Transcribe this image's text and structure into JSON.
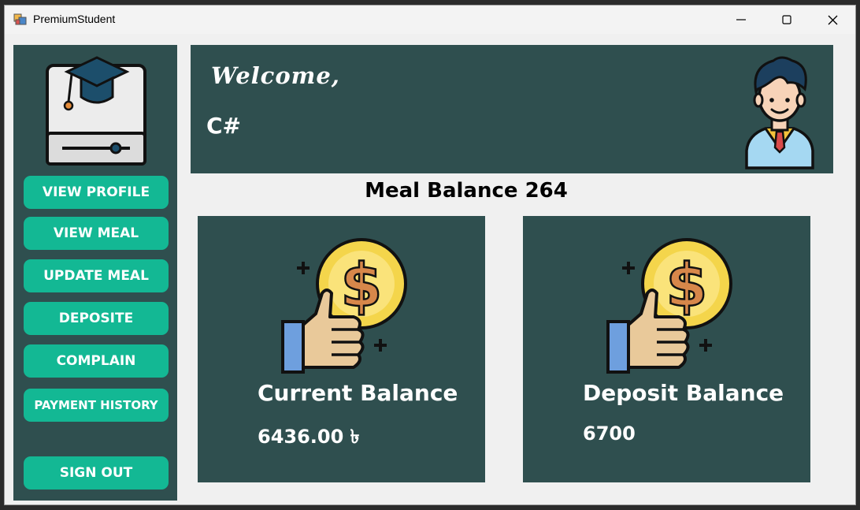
{
  "window": {
    "title": "PremiumStudent",
    "controls": {
      "minimize": "minimize-icon",
      "maximize": "maximize-icon",
      "close": "close-icon"
    }
  },
  "sidebar": {
    "logo": "graduation-cap-logo-icon",
    "buttons": [
      {
        "label": "VIEW PROFILE"
      },
      {
        "label": "VIEW MEAL"
      },
      {
        "label": "UPDATE MEAL"
      },
      {
        "label": "DEPOSITE"
      },
      {
        "label": "COMPLAIN"
      },
      {
        "label": "PAYMENT HISTORY"
      },
      {
        "label": "SIGN OUT"
      }
    ]
  },
  "header": {
    "welcome": "Welcome,",
    "username": "C#",
    "avatar": "graduate-student-avatar-icon"
  },
  "meal_balance": {
    "label": "Meal Balance",
    "value": "264"
  },
  "cards": [
    {
      "title": "Current Balance",
      "value": "6436.00 ৳",
      "icon": "thumbs-up-coin-icon"
    },
    {
      "title": "Deposit Balance",
      "value": "6700",
      "icon": "thumbs-up-coin-icon"
    }
  ],
  "colors": {
    "panel": "#2f4f4f",
    "button": "#13b894",
    "background": "#f0f0f0"
  }
}
